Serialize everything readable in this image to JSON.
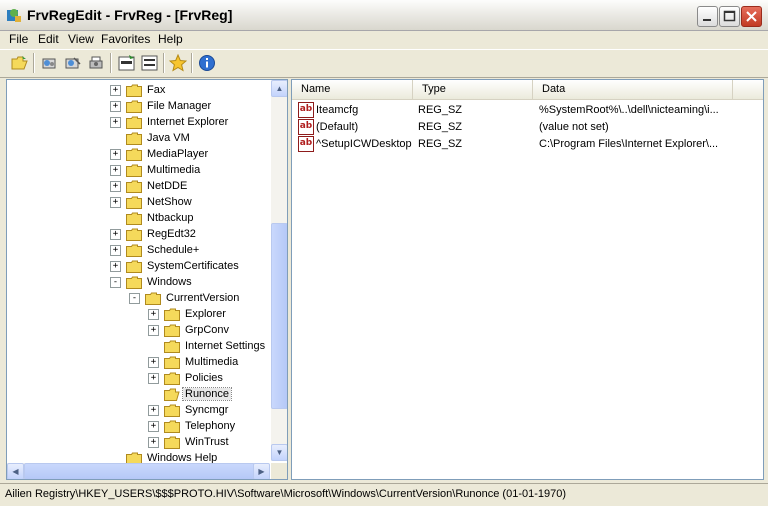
{
  "window": {
    "title": "FrvRegEdit - FrvReg - [FrvReg]"
  },
  "menu": [
    {
      "label": "File"
    },
    {
      "label": "Edit"
    },
    {
      "label": "View"
    },
    {
      "label": "Favorites"
    },
    {
      "label": "Help"
    }
  ],
  "toolbar": {
    "buttons": [
      {
        "icon": "open-folder-icon"
      },
      {
        "icon": "connect-registry-icon"
      },
      {
        "icon": "disconnect-registry-icon"
      },
      {
        "icon": "print-icon"
      },
      {
        "icon": "hkey-export-icon"
      },
      {
        "icon": "binary-data-icon"
      },
      {
        "icon": "favorite-star-icon"
      },
      {
        "icon": "info-icon"
      }
    ]
  },
  "tree": {
    "items": [
      {
        "label": "Fax",
        "expander": "+",
        "level": 0
      },
      {
        "label": "File Manager",
        "expander": "+",
        "level": 0
      },
      {
        "label": "Internet Explorer",
        "expander": "+",
        "level": 0
      },
      {
        "label": "Java VM",
        "expander": "",
        "level": 0
      },
      {
        "label": "MediaPlayer",
        "expander": "+",
        "level": 0
      },
      {
        "label": "Multimedia",
        "expander": "+",
        "level": 0
      },
      {
        "label": "NetDDE",
        "expander": "+",
        "level": 0
      },
      {
        "label": "NetShow",
        "expander": "+",
        "level": 0
      },
      {
        "label": "Ntbackup",
        "expander": "",
        "level": 0
      },
      {
        "label": "RegEdt32",
        "expander": "+",
        "level": 0
      },
      {
        "label": "Schedule+",
        "expander": "+",
        "level": 0
      },
      {
        "label": "SystemCertificates",
        "expander": "+",
        "level": 0
      },
      {
        "label": "Windows",
        "expander": "-",
        "level": 0
      },
      {
        "label": "CurrentVersion",
        "expander": "-",
        "level": 1
      },
      {
        "label": "Explorer",
        "expander": "+",
        "level": 2
      },
      {
        "label": "GrpConv",
        "expander": "+",
        "level": 2
      },
      {
        "label": "Internet Settings",
        "expander": "",
        "level": 2
      },
      {
        "label": "Multimedia",
        "expander": "+",
        "level": 2
      },
      {
        "label": "Policies",
        "expander": "+",
        "level": 2
      },
      {
        "label": "Runonce",
        "expander": "",
        "level": 2,
        "selected": true
      },
      {
        "label": "Syncmgr",
        "expander": "+",
        "level": 2
      },
      {
        "label": "Telephony",
        "expander": "+",
        "level": 2
      },
      {
        "label": "WinTrust",
        "expander": "+",
        "level": 2
      },
      {
        "label": "Windows Help",
        "expander": "",
        "level": 0
      }
    ]
  },
  "list": {
    "columns": [
      "Name",
      "Type",
      "Data"
    ],
    "rows": [
      {
        "name": "Iteamcfg",
        "type": "REG_SZ",
        "data": "%SystemRoot%\\..\\dell\\nicteaming\\i..."
      },
      {
        "name": "(Default)",
        "type": "REG_SZ",
        "data": "(value not set)"
      },
      {
        "name": "^SetupICWDesktop",
        "type": "REG_SZ",
        "data": "C:\\Program Files\\Internet Explorer\\..."
      }
    ]
  },
  "status": {
    "text": "Ailien Registry\\HKEY_USERS\\$$$PROTO.HIV\\Software\\Microsoft\\Windows\\CurrentVersion\\Runonce (01-01-1970)"
  },
  "colors": {
    "folder": "#F5D95B",
    "folder_edge": "#B08A1E",
    "selection": "#E8E8E8",
    "pane_border": "#7F9DB9"
  }
}
